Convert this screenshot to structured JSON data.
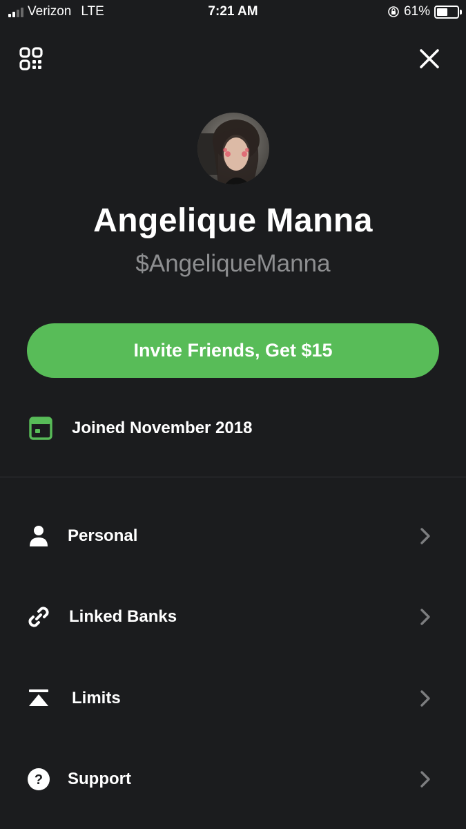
{
  "status_bar": {
    "carrier": "Verizon",
    "network": "LTE",
    "time": "7:21 AM",
    "battery_percent": "61%",
    "battery_level": 0.61
  },
  "header": {
    "left_icon": "qr-code-icon",
    "right_icon": "close-icon"
  },
  "profile": {
    "name": "Angelique Manna",
    "cashtag": "$AngeliqueManna"
  },
  "invite_button": {
    "label": "Invite Friends, Get $15"
  },
  "joined": {
    "icon": "calendar-icon",
    "text": "Joined November 2018"
  },
  "menu": [
    {
      "icon": "person-icon",
      "label": "Personal"
    },
    {
      "icon": "link-icon",
      "label": "Linked Banks"
    },
    {
      "icon": "limits-icon",
      "label": "Limits"
    },
    {
      "icon": "help-icon",
      "label": "Support"
    }
  ],
  "colors": {
    "background": "#1b1c1e",
    "accent_green": "#58bc58",
    "secondary_text": "#8d8e90"
  }
}
